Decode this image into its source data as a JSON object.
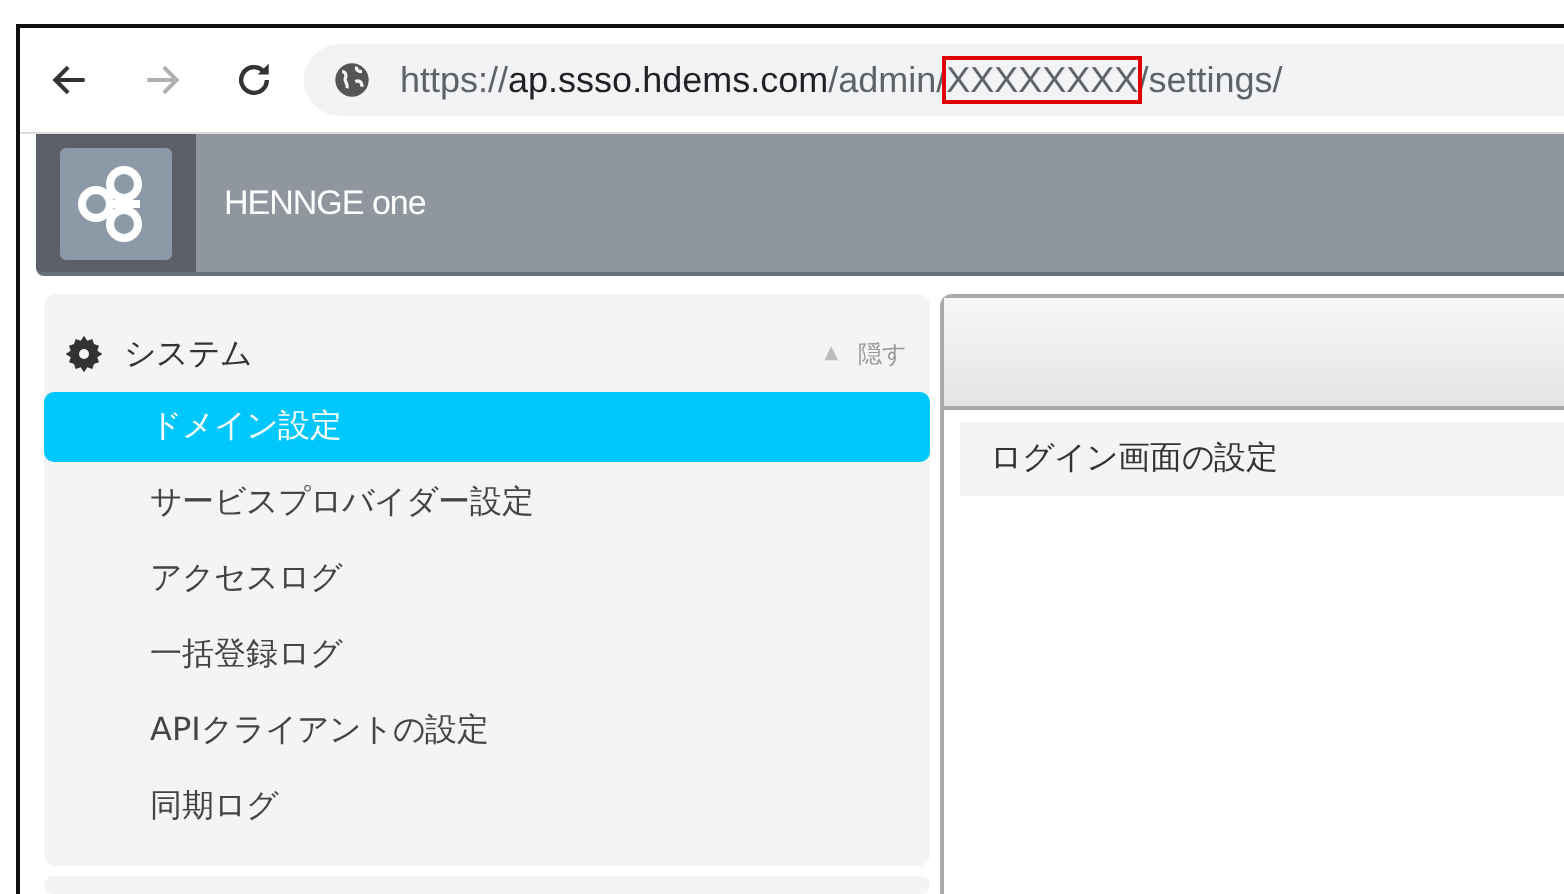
{
  "browser": {
    "url_segments": [
      {
        "text": "https://",
        "kind": "scheme",
        "highlighted": false
      },
      {
        "text": "ap.ssso.hdems.com",
        "kind": "host",
        "highlighted": false
      },
      {
        "text": "/admin/",
        "kind": "path",
        "highlighted": false
      },
      {
        "text": "XXXXXXXX",
        "kind": "path",
        "highlighted": true
      },
      {
        "text": "/settings/",
        "kind": "path",
        "highlighted": false
      }
    ]
  },
  "header": {
    "brand": "HENNGE one"
  },
  "sidebar": {
    "section": {
      "title": "システム",
      "toggle_icon": "▲",
      "toggle_label": "隠す"
    },
    "items": [
      {
        "label": "ドメイン設定",
        "selected": true
      },
      {
        "label": "サービスプロバイダー設定",
        "selected": false
      },
      {
        "label": "アクセスログ",
        "selected": false
      },
      {
        "label": "一括登録ログ",
        "selected": false
      },
      {
        "label": "APIクライアントの設定",
        "selected": false
      },
      {
        "label": "同期ログ",
        "selected": false
      }
    ]
  },
  "main": {
    "rows": [
      "ログイン画面の設定"
    ]
  }
}
